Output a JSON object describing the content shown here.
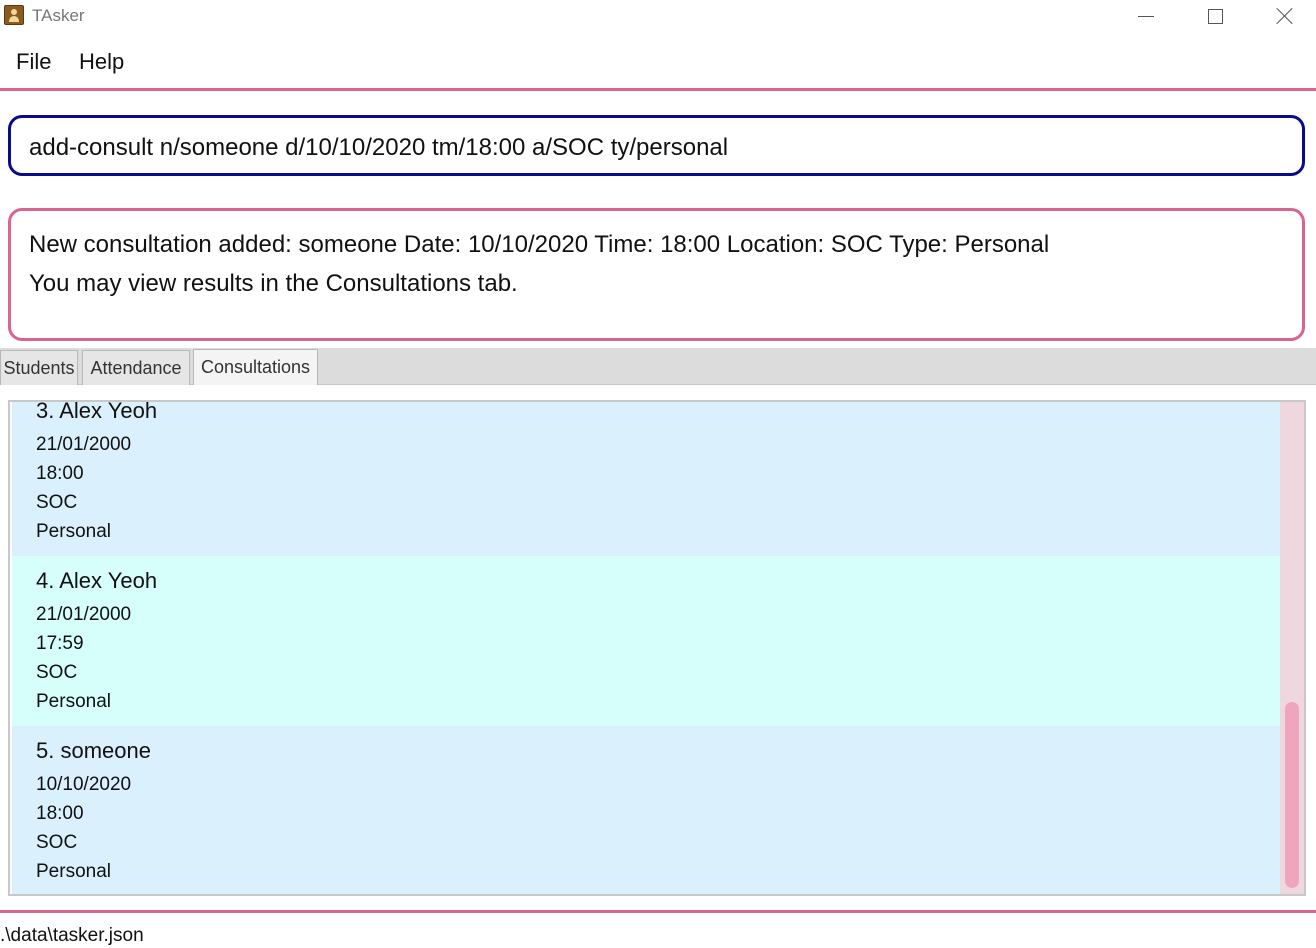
{
  "window": {
    "title": "TAsker",
    "icon": "app-icon"
  },
  "menu": {
    "file": "File",
    "help": "Help"
  },
  "command": {
    "text": "add-consult n/someone d/10/10/2020 tm/18:00 a/SOC ty/personal"
  },
  "result": {
    "line1": "New consultation added: someone Date: 10/10/2020 Time: 18:00 Location: SOC Type: Personal",
    "line2": "You may view results in the Consultations tab."
  },
  "tabs": [
    {
      "label": "Students",
      "selected": false
    },
    {
      "label": "Attendance",
      "selected": false
    },
    {
      "label": "Consultations",
      "selected": true
    }
  ],
  "consultations": [
    {
      "index": "3.",
      "name": "Alex Yeoh",
      "date": "21/01/2000",
      "time": "18:00",
      "location": "SOC",
      "type": "Personal",
      "title": "3.  Alex Yeoh"
    },
    {
      "index": "4.",
      "name": "Alex Yeoh",
      "date": "21/01/2000",
      "time": "17:59",
      "location": "SOC",
      "type": "Personal",
      "title": "4.  Alex Yeoh"
    },
    {
      "index": "5.",
      "name": "someone",
      "date": "10/10/2020",
      "time": "18:00",
      "location": "SOC",
      "type": "Personal",
      "title": "5.  someone"
    }
  ],
  "status": {
    "path": ".\\data\\tasker.json"
  },
  "colors": {
    "accent": "#d9648f",
    "command_border": "#0a0a8c",
    "card_blue": "#dbf0fd",
    "card_cyan": "#d6fffc",
    "scroll_thumb": "#efa5bd"
  }
}
